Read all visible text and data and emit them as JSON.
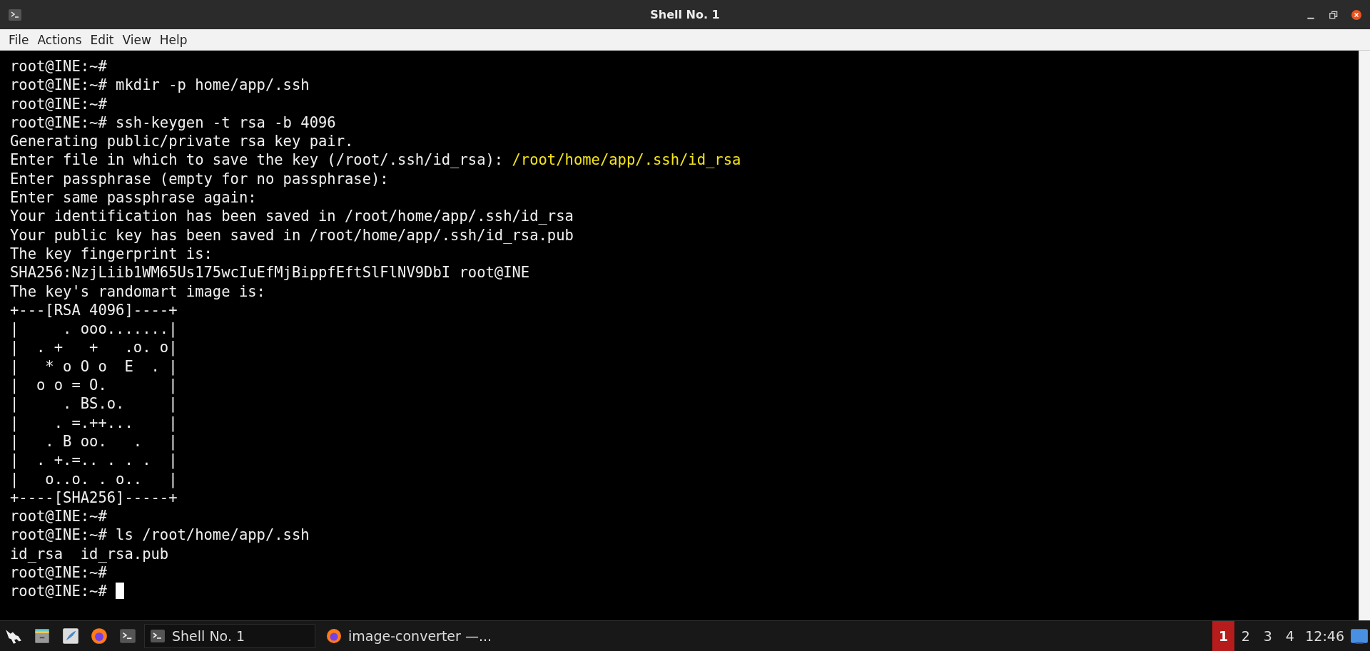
{
  "window": {
    "title": "Shell No. 1"
  },
  "menu": [
    "File",
    "Actions",
    "Edit",
    "View",
    "Help"
  ],
  "terminal": {
    "lines": [
      {
        "text": "root@INE:~#"
      },
      {
        "text": "root@INE:~# mkdir -p home/app/.ssh"
      },
      {
        "text": "root@INE:~#"
      },
      {
        "text": "root@INE:~# ssh-keygen -t rsa -b 4096"
      },
      {
        "text": "Generating public/private rsa key pair."
      },
      {
        "text": "Enter file in which to save the key (/root/.ssh/id_rsa): ",
        "input": "/root/home/app/.ssh/id_rsa"
      },
      {
        "text": "Enter passphrase (empty for no passphrase):"
      },
      {
        "text": "Enter same passphrase again:"
      },
      {
        "text": "Your identification has been saved in /root/home/app/.ssh/id_rsa"
      },
      {
        "text": "Your public key has been saved in /root/home/app/.ssh/id_rsa.pub"
      },
      {
        "text": "The key fingerprint is:"
      },
      {
        "text": "SHA256:NzjLiib1WM65Us175wcIuEfMjBippfEftSlFlNV9DbI root@INE"
      },
      {
        "text": "The key's randomart image is:"
      },
      {
        "text": "+---[RSA 4096]----+"
      },
      {
        "text": "|     . ooo.......|"
      },
      {
        "text": "|  . +   +   .o. o|"
      },
      {
        "text": "|   * o O o  E  . |"
      },
      {
        "text": "|  o o = O.       |"
      },
      {
        "text": "|     . BS.o.     |"
      },
      {
        "text": "|    . =.++...    |"
      },
      {
        "text": "|   . B oo.   .   |"
      },
      {
        "text": "|  . +.=.. . . .  |"
      },
      {
        "text": "|   o..o. . o..   |"
      },
      {
        "text": "+----[SHA256]-----+"
      },
      {
        "text": "root@INE:~#"
      },
      {
        "text": "root@INE:~# ls /root/home/app/.ssh"
      },
      {
        "text": "id_rsa  id_rsa.pub"
      },
      {
        "text": "root@INE:~#"
      },
      {
        "text": "root@INE:~# ",
        "cursor": true
      }
    ]
  },
  "taskbar": {
    "launchers": [
      {
        "kind": "dragon"
      },
      {
        "kind": "files"
      },
      {
        "kind": "editor"
      },
      {
        "kind": "browser"
      },
      {
        "kind": "terminal"
      }
    ],
    "tasks": [
      {
        "label": "Shell No. 1",
        "kind": "terminal",
        "selected": true
      },
      {
        "label": "image-converter —...",
        "kind": "browser",
        "selected": false
      }
    ],
    "workspaces": [
      {
        "label": "1",
        "selected": true
      },
      {
        "label": "2",
        "selected": false
      },
      {
        "label": "3",
        "selected": false
      },
      {
        "label": "4",
        "selected": false
      }
    ],
    "clock": "12:46"
  }
}
